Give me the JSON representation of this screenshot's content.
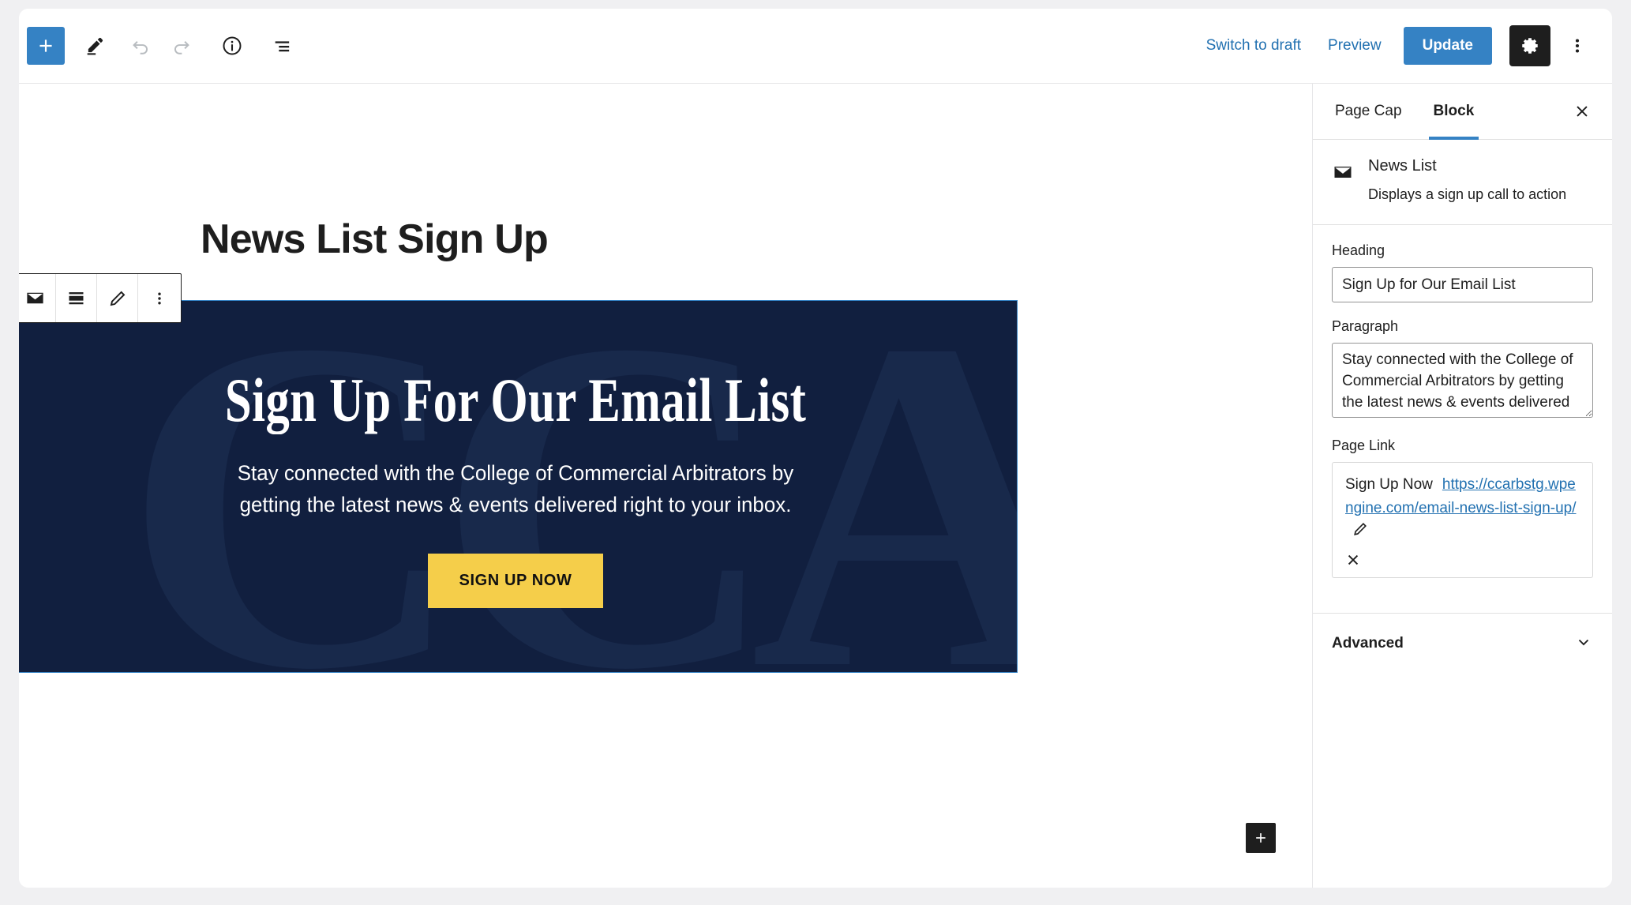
{
  "header": {
    "add_block_title": "Toggle block inserter",
    "tools_title": "Tools",
    "undo_title": "Undo",
    "redo_title": "Redo",
    "details_title": "Details",
    "list_view_title": "List View",
    "switch_to_draft_label": "Switch to draft",
    "preview_label": "Preview",
    "update_label": "Update",
    "settings_title": "Settings",
    "options_title": "Options"
  },
  "canvas": {
    "post_title": "News List Sign Up",
    "block_toolbar": {
      "block_type_title": "News List",
      "align_title": "Change alignment",
      "edit_title": "Edit",
      "more_title": "Options"
    },
    "news_block": {
      "watermark": "CCA",
      "heading": "Sign Up For Our Email List",
      "paragraph": "Stay connected with the College of Commercial Arbitrators by getting the latest news & events delivered right to your inbox.",
      "cta_label": "SIGN UP NOW",
      "background_color": "#111f3f",
      "cta_color": "#f5ce4a",
      "selection_color": "#3582c4"
    },
    "appender_title": "Add block"
  },
  "sidebar": {
    "tabs": [
      {
        "label": "Page Cap",
        "active": false
      },
      {
        "label": "Block",
        "active": true
      }
    ],
    "close_title": "Close Settings",
    "block_card": {
      "icon": "envelope-icon",
      "title": "News List",
      "description": "Displays a sign up call to action"
    },
    "fields": {
      "heading_label": "Heading",
      "heading_value": "Sign Up for Our Email List",
      "paragraph_label": "Paragraph",
      "paragraph_value": "Stay connected with the College of Commercial Arbitrators by getting the latest news & events delivered",
      "page_link_label": "Page Link",
      "page_link_text": "Sign Up Now",
      "page_link_url": "https://ccarbstg.wpengine.com/email-news-list-sign-up/"
    },
    "advanced_label": "Advanced",
    "accent_color": "#3582c4"
  }
}
